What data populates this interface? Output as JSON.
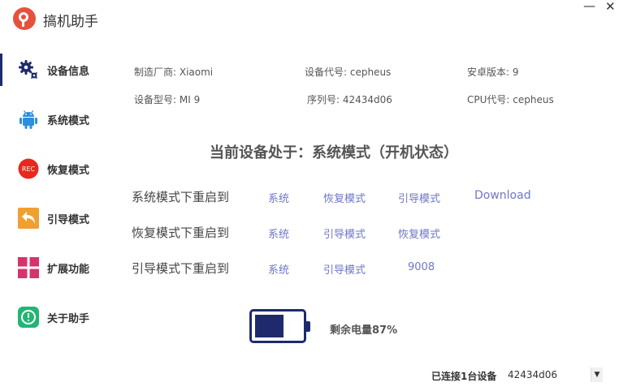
{
  "app": {
    "title": "搞机助手",
    "minimize": "—",
    "close": "✕"
  },
  "sidebar": {
    "items": [
      {
        "label": "设备信息",
        "icon": "gear-icon"
      },
      {
        "label": "系统模式",
        "icon": "android-icon"
      },
      {
        "label": "恢复模式",
        "icon": "rec-icon",
        "icon_text": "REC"
      },
      {
        "label": "引导模式",
        "icon": "back-arrow-icon"
      },
      {
        "label": "扩展功能",
        "icon": "grid-icon"
      },
      {
        "label": "关于助手",
        "icon": "info-icon"
      }
    ]
  },
  "device_info": {
    "manufacturer": "制造厂商: Xiaomi",
    "device_code": "设备代号: cepheus",
    "android_version": "安卓版本: 9",
    "model": "设备型号: MI 9",
    "serial": "序列号: 42434d06",
    "cpu_code": "CPU代号: cepheus"
  },
  "status": {
    "text": "当前设备处于：系统模式（开机状态）"
  },
  "reboot_rows": [
    {
      "label": "系统模式下重启到",
      "links": [
        "系统",
        "恢复模式",
        "引导模式",
        "Download"
      ]
    },
    {
      "label": "恢复模式下重启到",
      "links": [
        "系统",
        "引导模式",
        "恢复模式"
      ]
    },
    {
      "label": "引导模式下重启到",
      "links": [
        "系统",
        "引导模式",
        "9008"
      ]
    }
  ],
  "battery": {
    "level": 0.87,
    "text": "剩余电量87%"
  },
  "footer": {
    "connected": "已连接1台设备",
    "device_select": "42434d06"
  },
  "colors": {
    "accent": "#1f2a6d",
    "link": "#6f77c6",
    "logo": "#e8503e"
  }
}
